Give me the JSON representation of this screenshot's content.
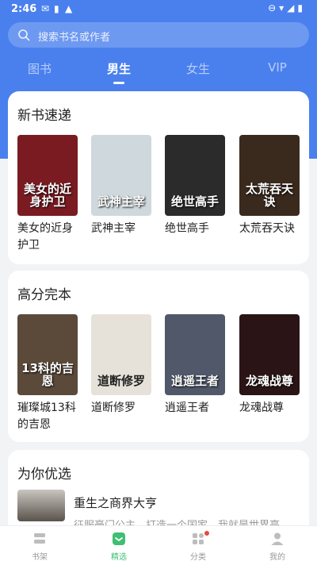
{
  "status_bar": {
    "time": "2:46"
  },
  "search": {
    "placeholder": "搜索书名或作者"
  },
  "tabs": [
    {
      "label": "图书",
      "active": false
    },
    {
      "label": "男生",
      "active": true
    },
    {
      "label": "女生",
      "active": false
    },
    {
      "label": "VIP",
      "active": false
    }
  ],
  "sections": [
    {
      "title": "新书速递",
      "books": [
        {
          "title": "美女的近身护卫",
          "cover_text": "美女的近身护卫",
          "cover_color": "#7a1b22"
        },
        {
          "title": "武神主宰",
          "cover_text": "武神主宰",
          "cover_color": "#cfd8dc"
        },
        {
          "title": "绝世高手",
          "cover_text": "绝世高手",
          "cover_color": "#2b2b2b"
        },
        {
          "title": "太荒吞天诀",
          "cover_text": "太荒吞天诀",
          "cover_color": "#3a2a1e"
        }
      ]
    },
    {
      "title": "高分完本",
      "books": [
        {
          "title": "璀璨城13科的吉恩",
          "cover_text": "13科的吉恩",
          "cover_color": "#5b4a3a"
        },
        {
          "title": "道断修罗",
          "cover_text": "道断修罗",
          "cover_color": "#e6e2da"
        },
        {
          "title": "逍遥王者",
          "cover_text": "逍遥王者",
          "cover_color": "#50586a"
        },
        {
          "title": "龙魂战尊",
          "cover_text": "龙魂战尊",
          "cover_color": "#2a1416"
        }
      ]
    }
  ],
  "picks": {
    "title": "为你优选",
    "item": {
      "title": "重生之商界大亨",
      "description": "征服豪门公主，打造一个国家，我就是世界亭"
    }
  },
  "bottom_nav": [
    {
      "label": "书架",
      "active": false
    },
    {
      "label": "精选",
      "active": true
    },
    {
      "label": "分类",
      "active": false,
      "badge": true
    },
    {
      "label": "我的",
      "active": false
    }
  ],
  "colors": {
    "primary": "#4a80ee",
    "nav_active": "#3fbf72",
    "badge": "#e8493e"
  }
}
